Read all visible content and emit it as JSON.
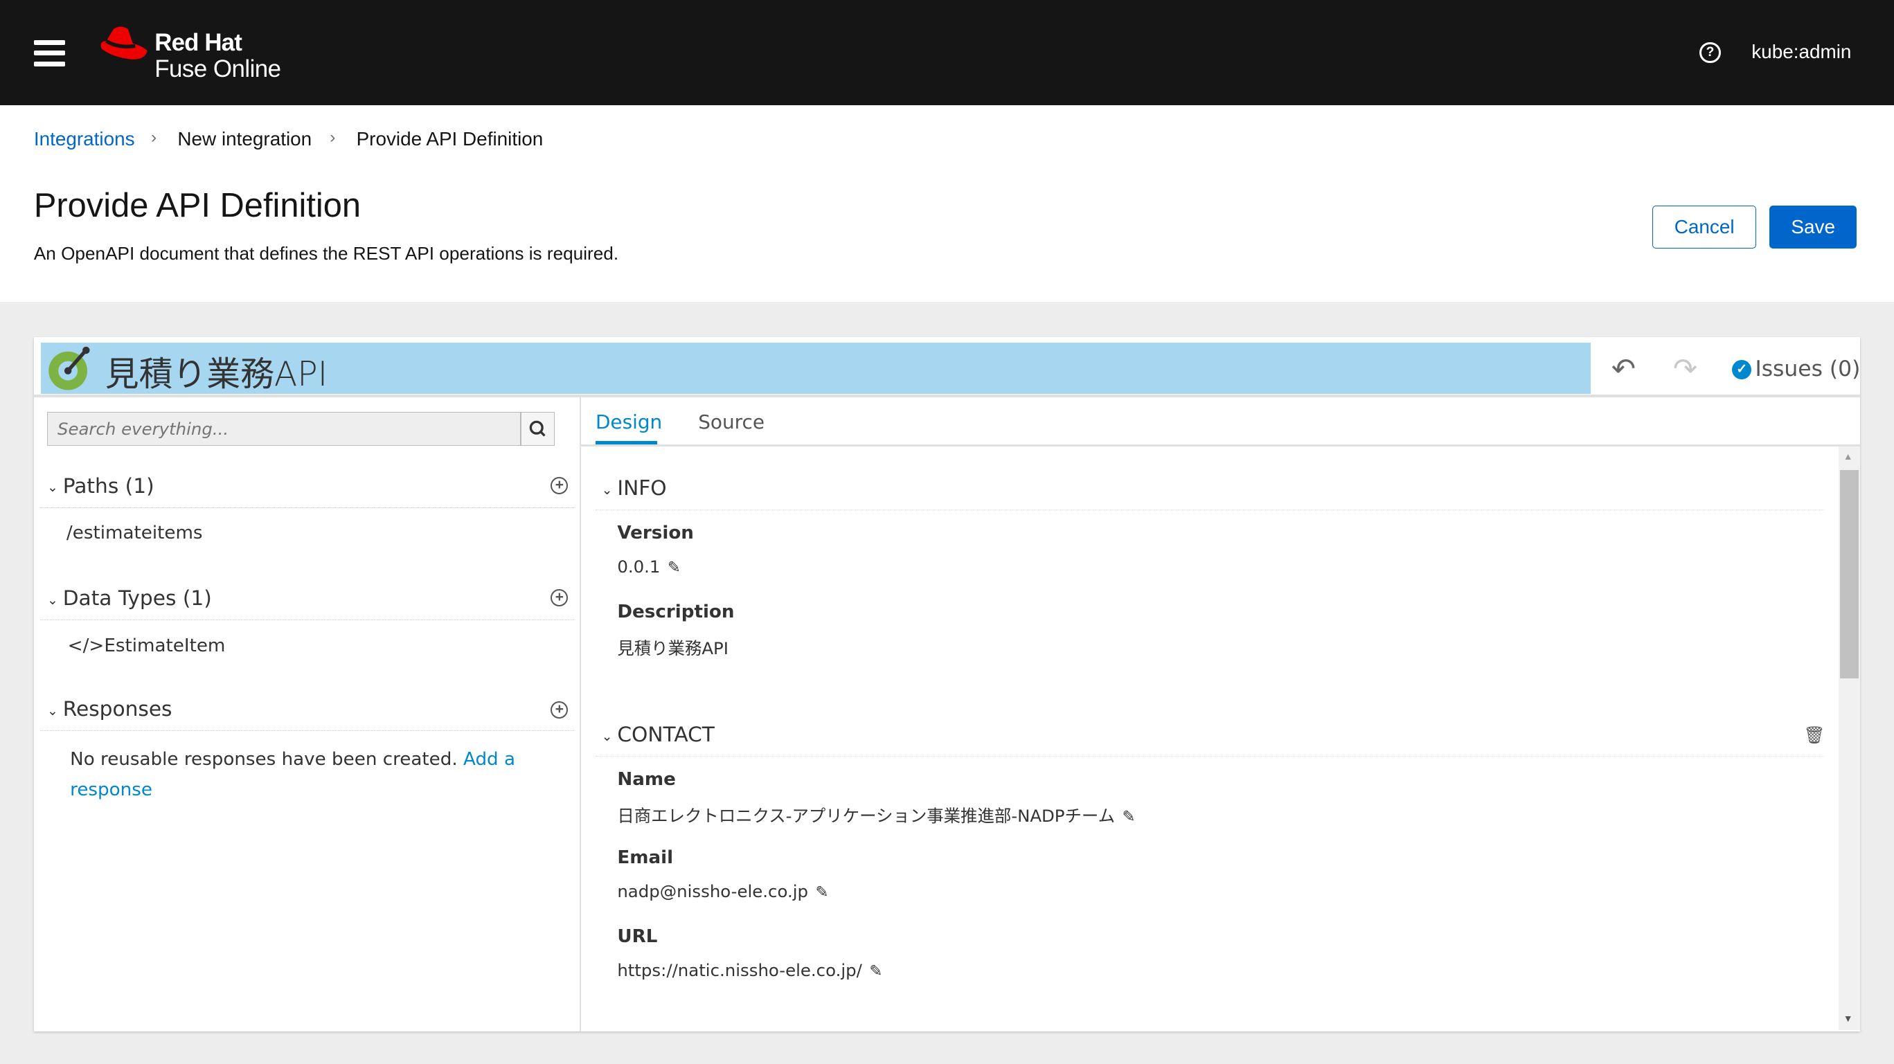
{
  "header": {
    "brand_line1": "Red Hat",
    "brand_line2": "Fuse Online",
    "user": "kube:admin",
    "icons": [
      "menu-icon",
      "redhat-logo",
      "help-icon"
    ]
  },
  "breadcrumb": [
    {
      "label": "Integrations",
      "link": true
    },
    {
      "label": "New integration"
    },
    {
      "label": "Provide API Definition"
    }
  ],
  "page": {
    "title": "Provide API Definition",
    "subtitle": "An OpenAPI document that defines the REST API operations is required.",
    "cancel": "Cancel",
    "save": "Save"
  },
  "editor": {
    "api_title": "見積り業務API",
    "issues": "Issues (0)",
    "search_placeholder": "Search everything...",
    "sections": [
      {
        "title": "Paths (1)",
        "items": [
          "/estimateitems"
        ]
      },
      {
        "title": "Data Types (1)",
        "items": [
          "EstimateItem"
        ]
      },
      {
        "title": "Responses",
        "empty_text": "No reusable responses have been created.",
        "add_link": "Add a response"
      }
    ],
    "tabs": [
      {
        "label": "Design",
        "active": true
      },
      {
        "label": "Source"
      }
    ],
    "info": {
      "title": "INFO",
      "version_label": "Version",
      "version": "0.0.1",
      "description_label": "Description",
      "description": "見積り業務API"
    },
    "contact": {
      "title": "CONTACT",
      "name_label": "Name",
      "name": "日商エレクトロニクス-アプリケーション事業推進部-NADPチーム",
      "email_label": "Email",
      "email": "nadp@nissho-ele.co.jp",
      "url_label": "URL",
      "url": "https://natic.nissho-ele.co.jp/"
    }
  },
  "colors": {
    "header_bg": "#151515",
    "primary": "#0066cc",
    "api_bar": "#a6d6f0",
    "issues_ok": "#0088ce"
  }
}
